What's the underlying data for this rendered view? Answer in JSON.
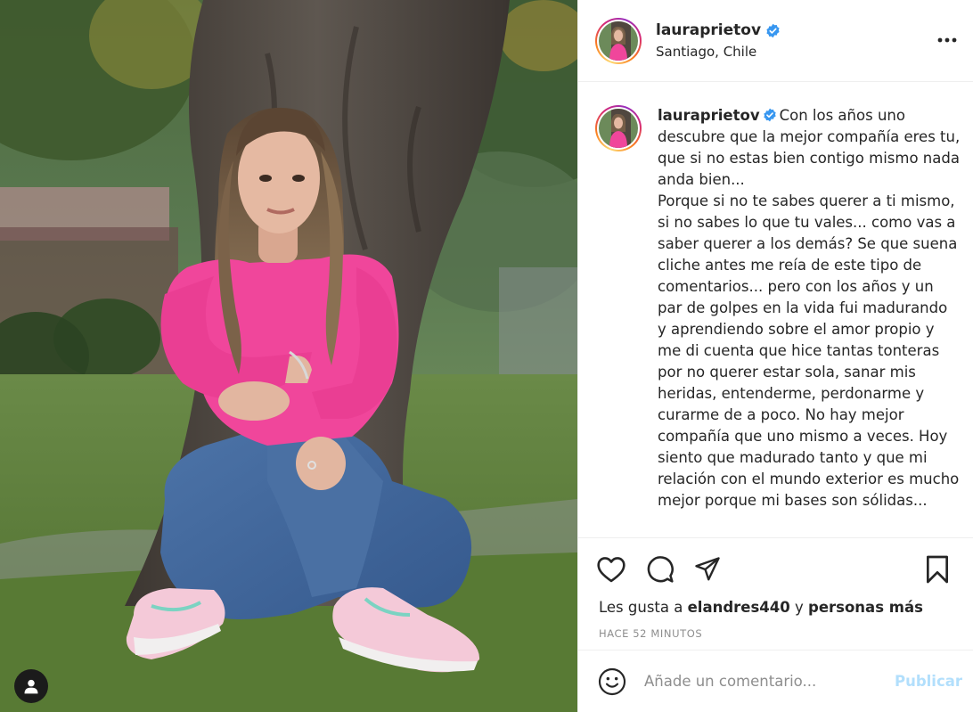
{
  "post": {
    "username": "lauraprietov",
    "location": "Santiago, Chile",
    "caption_username": "lauraprietov",
    "caption": "Con los años uno descubre que la mejor compañía eres tu, que si no estas bien contigo mismo nada anda bien...\nPorque si no te sabes querer a ti mismo, si no sabes lo que tu vales... como vas a saber querer a los demás? Se que suena cliche antes me reía de este tipo de comentarios... pero con los años y un par de golpes en la vida fui madurando y aprendiendo sobre el amor propio y me di cuenta que hice tantas tonteras por no querer estar sola, sanar mis heridas, entenderme, perdonarme y curarme de a poco. No hay mejor compañía que uno mismo a veces. Hoy siento que madurado tanto y que mi relación con el mundo exterior es mucho mejor porque mi bases son sólidas...",
    "likes_prefix": "Les gusta a",
    "likes_user": "elandres440",
    "likes_joiner": "y",
    "likes_others": "personas más",
    "time_ago": "HACE 52 MINUTOS"
  },
  "comment_box": {
    "placeholder": "Añade un comentario...",
    "publish_label": "Publicar"
  },
  "icons": {
    "verified": "verified-badge-icon",
    "more": "more-options-icon",
    "like": "heart-icon",
    "comment": "comment-bubble-icon",
    "share": "paper-plane-icon",
    "save": "bookmark-icon",
    "emoji": "smiley-icon",
    "tag": "user-tag-icon"
  },
  "colors": {
    "verified_blue": "#3897f0",
    "publish_disabled": "#b2dffc",
    "muted_text": "#8e8e8e",
    "border": "#efefef"
  }
}
